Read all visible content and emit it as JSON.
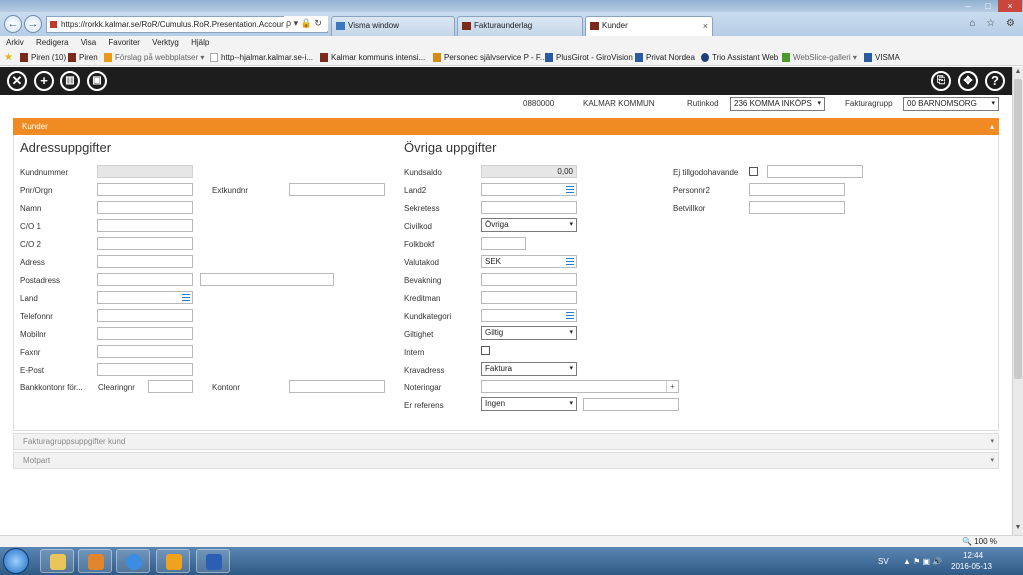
{
  "browser": {
    "url": "https://rorkk.kalmar.se/RoR/Cumulus.RoR.Presentation.AccountF",
    "url_icons": "ρ ▾ 🔒 ↻",
    "tabs": [
      {
        "label": "Visma window",
        "active": false
      },
      {
        "label": "Fakturaunderlag",
        "active": false
      },
      {
        "label": "Kunder",
        "active": true
      }
    ],
    "tab_close": "×",
    "window_controls": {
      "min": "–",
      "max": "□",
      "close": "×"
    },
    "right_icons": "⌂ ☆ ⚙"
  },
  "menu": [
    "Arkiv",
    "Redigera",
    "Visa",
    "Favoriter",
    "Verktyg",
    "Hjälp"
  ],
  "favorites": [
    {
      "label": "Piren (10)",
      "color": "#7a2b1b"
    },
    {
      "label": "Piren",
      "color": "#7a2b1b"
    },
    {
      "label": "Förslag på webbplatser ▾",
      "color": "#e89b16"
    },
    {
      "label": "http--hjalmar.kalmar.se-i...",
      "color": "#ffffff"
    },
    {
      "label": "Kalmar kommuns intensi...",
      "color": "#7a2b1b"
    },
    {
      "label": "Personec självservice P - F...",
      "color": "#d28b17"
    },
    {
      "label": "PlusGirot - GiroVision",
      "color": "#2a5aa0"
    },
    {
      "label": "Privat Nordea",
      "color": "#2a5aa0"
    },
    {
      "label": "Trio Assistant Web",
      "color": "#1d3f7a"
    },
    {
      "label": "WebSlice-galleri ▾",
      "color": "#4c9a2a"
    },
    {
      "label": "VISMA",
      "color": "#2a5aa0"
    }
  ],
  "toolbar": {
    "close": "✕",
    "add": "+",
    "delete": "▥",
    "save": "▣",
    "copy": "⎘",
    "move": "✥",
    "help": "?"
  },
  "header": {
    "number": "0880000",
    "org": "KALMAR KOMMUN",
    "rutinkod_label": "Rutinkod",
    "rutinkod_value": "236 KOMMA INKÖPS",
    "fakturagrupp_label": "Fakturagrupp",
    "fakturagrupp_value": "00 BARNOMSORG"
  },
  "panel": {
    "title": "Kunder",
    "collapse": "▴"
  },
  "left": {
    "title": "Adressuppgifter",
    "kundnummer": "Kundnummer",
    "pnr": "Pnr/Orgn",
    "extkundnr": "Extkundnr",
    "namn": "Namn",
    "co1": "C/O 1",
    "co2": "C/O 2",
    "adress": "Adress",
    "postadress": "Postadress",
    "land": "Land",
    "telefonnr": "Telefonnr",
    "mobilnr": "Mobilnr",
    "faxnr": "Faxnr",
    "epost": "E-Post",
    "bankkonto": "Bankkontonr för...",
    "clearingnr": "Clearingnr",
    "kontonr": "Kontonr"
  },
  "middle": {
    "title": "Övriga uppgifter",
    "kundsaldo": "Kundsaldo",
    "kundsaldo_value": "0,00",
    "land2": "Land2",
    "sekretess": "Sekretess",
    "civilkod": "Civilkod",
    "civilkod_value": "Övriga",
    "folkbokf": "Folkbokf",
    "valutakod": "Valutakod",
    "valutakod_value": "SEK",
    "bevakning": "Bevakning",
    "kreditman": "Kreditman",
    "kundkategori": "Kundkategori",
    "giltighet": "Giltighet",
    "giltighet_value": "Giltig",
    "intern": "Intern",
    "kravadress": "Kravadress",
    "kravadress_value": "Faktura",
    "noteringar": "Noteringar",
    "er_referens": "Er referens",
    "er_referens_value": "Ingen",
    "plus": "+"
  },
  "right": {
    "ej_tillgodo": "Ej tillgodohavande",
    "personnr2": "Personnr2",
    "betvillkor": "Betvillkor"
  },
  "dropdown_arrow": "▾",
  "collapsed_panels": [
    {
      "label": "Fakturagruppsuppgifter kund"
    },
    {
      "label": "Motpart"
    }
  ],
  "status": {
    "zoom": "🔍 100 %"
  },
  "taskbar": {
    "lang": "SV",
    "time": "12:44",
    "date": "2016-05-13",
    "tray_icons": "▲ ⚑ ▣ 🔊"
  }
}
